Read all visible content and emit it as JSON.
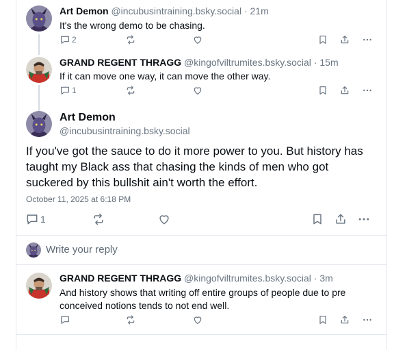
{
  "posts": [
    {
      "author": "Art Demon",
      "handle": "@incubusintraining.bsky.social",
      "dot": "·",
      "ago": "21m",
      "text": "It's the wrong demo to be chasing.",
      "reply_count": "2",
      "avatar": "demon-avatar"
    },
    {
      "author": "GRAND REGENT THRAGG",
      "handle": "@kingofviltrumites.bsky.social",
      "dot": "·",
      "ago": "15m",
      "text": "If it can move one way, it can move the other way.",
      "reply_count": "1",
      "avatar": "thragg-avatar"
    }
  ],
  "focus": {
    "author": "Art Demon",
    "handle": "@incubusintraining.bsky.social",
    "text": "If you've got the sauce to do it more power to you. But history has taught my Black ass that chasing the kinds of men who got suckered by this bullshit ain't worth the effort.",
    "timestamp": "October 11, 2025 at 6:18 PM",
    "reply_count": "1"
  },
  "reply_box": {
    "placeholder": "Write your reply"
  },
  "replies": [
    {
      "author": "GRAND REGENT THRAGG",
      "handle": "@kingofviltrumites.bsky.social",
      "dot": "·",
      "ago": "3m",
      "text": "And history shows that writing off entire groups of people due to pre conceived notions tends to not end well.",
      "reply_count": ""
    }
  ],
  "colors": {
    "icon": "#6a7682",
    "border": "#e3e8ee",
    "text": "#0b0f14",
    "secondary": "#6a7682"
  }
}
